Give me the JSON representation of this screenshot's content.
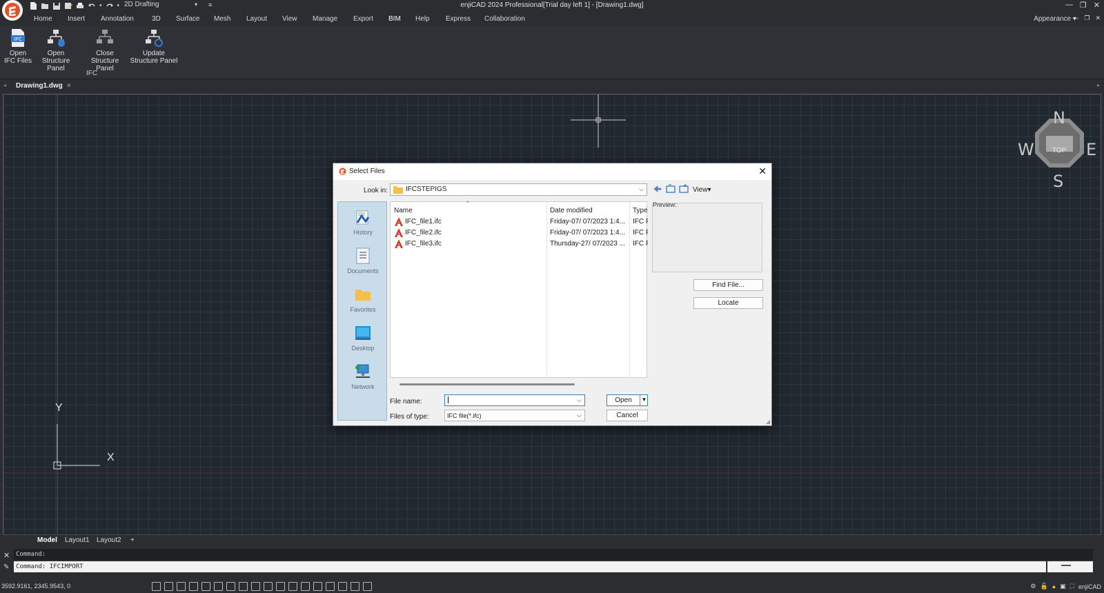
{
  "titlebar": {
    "workspace": "2D Drafting",
    "title": "enjiCAD 2024 Professional[Trial day left 1] - [Drawing1.dwg]",
    "minimize": "—",
    "restore": "❐",
    "close": "✕"
  },
  "menu": {
    "items": [
      "Home",
      "Insert",
      "Annotation",
      "3D",
      "Surface",
      "Mesh",
      "Layout",
      "View",
      "Manage",
      "Export",
      "BIM",
      "Help",
      "Express",
      "Collaboration"
    ],
    "active": "BIM",
    "appearance": "Appearance"
  },
  "ribbon": {
    "buttons": [
      {
        "line1": "Open",
        "line2": "IFC Files"
      },
      {
        "line1": "Open",
        "line2": "Structure Panel"
      },
      {
        "line1": "Close",
        "line2": "Structure Panel"
      },
      {
        "line1": "Update",
        "line2": "Structure Panel"
      }
    ],
    "group_label": "IFC"
  },
  "doc_tab": {
    "name": "Drawing1.dwg",
    "close": "×"
  },
  "viewcube": {
    "north": "N",
    "south": "S",
    "east": "E",
    "west": "W",
    "face": "TOP"
  },
  "ucs": {
    "x": "X",
    "y": "Y"
  },
  "layout_tabs": [
    "Model",
    "Layout1",
    "Layout2",
    "+"
  ],
  "command": {
    "history": "Command:",
    "current": "Command: IFCIMPORT"
  },
  "status": {
    "coords": "3592.9161, 2345.9543, 0",
    "app": "enjiCAD"
  },
  "dialog": {
    "title": "Select Files",
    "look_in_label": "Look in:",
    "look_in_value": "IFCSTEPIGS",
    "view_label": "View",
    "places": [
      "History",
      "Documents",
      "Favorites",
      "Desktop",
      "Network"
    ],
    "columns": [
      "Name",
      "Date modified",
      "Type"
    ],
    "files": [
      {
        "name": "IFC_file1.ifc",
        "date": "Friday-07/ 07/2023 1:4...",
        "type": "IFC Fi"
      },
      {
        "name": "IFC_file2.ifc",
        "date": "Friday-07/ 07/2023 1:4...",
        "type": "IFC Fi"
      },
      {
        "name": "IFC_file3.ifc",
        "date": "Thursday-27/ 07/2023 ...",
        "type": "IFC Fi"
      }
    ],
    "preview_label": "Preview:",
    "find_file": "Find File...",
    "locate": "Locate",
    "file_name_label": "File name:",
    "file_name_value": "",
    "files_of_type_label": "Files of type:",
    "files_of_type_value": "IFC file(*.ifc)",
    "open": "Open",
    "cancel": "Cancel"
  },
  "colors": {
    "accent": "#e8502a",
    "canvas": "#212830",
    "dialog_bg": "#f0f0f0",
    "places_bg": "#c9dcea"
  }
}
